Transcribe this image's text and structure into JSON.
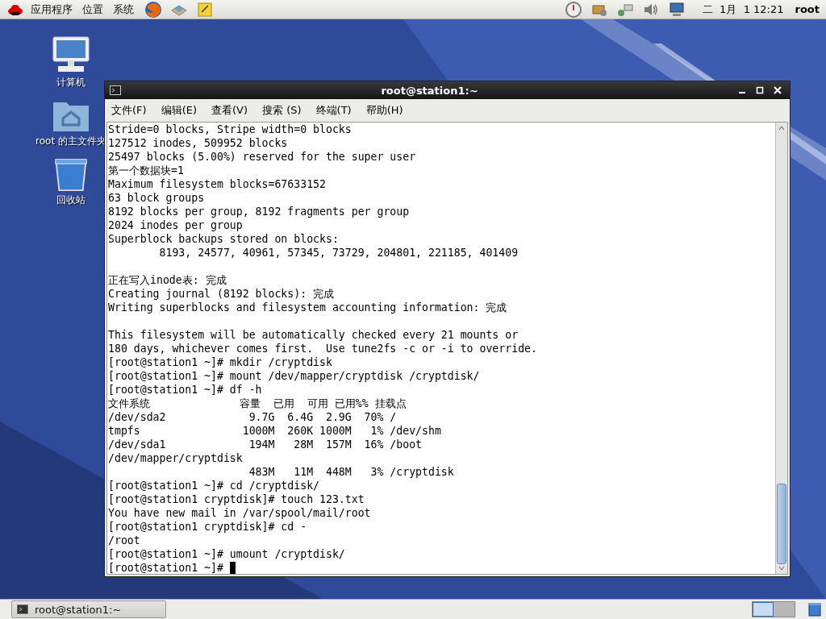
{
  "top_panel": {
    "menus": [
      "应用程序",
      "位置",
      "系统"
    ],
    "clock": "二  1月  1 12:21",
    "user": "root"
  },
  "desktop_icons": [
    {
      "kind": "computer",
      "label": "计算机"
    },
    {
      "kind": "home",
      "label": "root 的主文件夹"
    },
    {
      "kind": "trash",
      "label": "回收站"
    }
  ],
  "terminal": {
    "title": "root@station1:~",
    "menu": [
      "文件(F)",
      "编辑(E)",
      "查看(V)",
      "搜索 (S)",
      "终端(T)",
      "帮助(H)"
    ],
    "paragraphs": [
      [
        "Stride=0 blocks, Stripe width=0 blocks",
        "127512 inodes, 509952 blocks",
        "25497 blocks (5.00%) reserved for the super user",
        "第一个数据块=1",
        "Maximum filesystem blocks=67633152",
        "63 block groups",
        "8192 blocks per group, 8192 fragments per group",
        "2024 inodes per group",
        "Superblock backups stored on blocks:",
        "        8193, 24577, 40961, 57345, 73729, 204801, 221185, 401409"
      ],
      [
        "正在写入inode表: 完成",
        "Creating journal (8192 blocks): 完成",
        "Writing superblocks and filesystem accounting information: 完成"
      ],
      [
        "This filesystem will be automatically checked every 21 mounts or",
        "180 days, whichever comes first.  Use tune2fs -c or -i to override.",
        "[root@station1 ~]# mkdir /cryptdisk",
        "[root@station1 ~]# mount /dev/mapper/cryptdisk /cryptdisk/",
        "[root@station1 ~]# df -h",
        "文件系统              容量  已用  可用 已用%% 挂载点",
        "/dev/sda2             9.7G  6.4G  2.9G  70% /",
        "tmpfs                1000M  260K 1000M   1% /dev/shm",
        "/dev/sda1             194M   28M  157M  16% /boot",
        "/dev/mapper/cryptdisk",
        "                      483M   11M  448M   3% /cryptdisk",
        "[root@station1 ~]# cd /cryptdisk/",
        "[root@station1 cryptdisk]# touch 123.txt",
        "You have new mail in /var/spool/mail/root",
        "[root@station1 cryptdisk]# cd -",
        "/root",
        "[root@station1 ~]# umount /cryptdisk/",
        "[root@station1 ~]# "
      ]
    ]
  },
  "taskbar": {
    "tasks": [
      {
        "label": "root@station1:~",
        "selected": false
      }
    ],
    "workspaces": [
      {
        "selected": true
      },
      {
        "selected": false
      }
    ]
  }
}
